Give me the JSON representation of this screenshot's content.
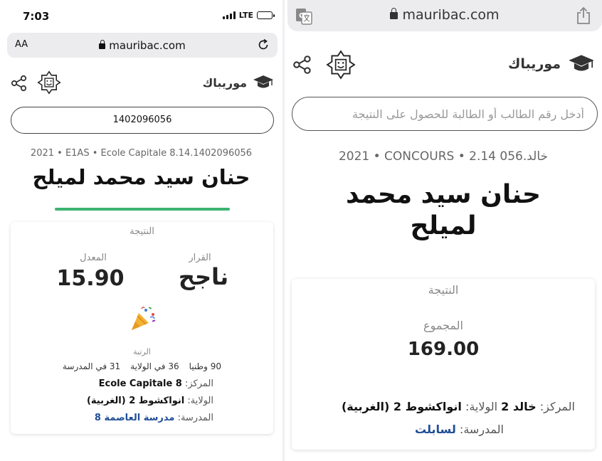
{
  "left": {
    "status_bar": {
      "time": "7:03",
      "network": "LTE"
    },
    "browser": {
      "aa": "AA",
      "url": "mauribac.com"
    },
    "header": {
      "brand": "موريباك"
    },
    "search": {
      "value": "1402096056"
    },
    "student": {
      "meta": "2021 • E1AS • Ecole Capitale 8.14.1402096056",
      "name": "حنان سيد محمد لميلح"
    },
    "result": {
      "title": "النتيجة",
      "decision_label": "القرار",
      "decision_value": "ناجح",
      "average_label": "المعدل",
      "average_value": "15.90",
      "rank_label": "الرتبة",
      "rank_school": "31 في المدرسة",
      "rank_wilaya": "36 في الولاية",
      "rank_national": "90 وطنيا",
      "center_label": "المركز:",
      "center_value": "Ecole Capitale 8",
      "wilaya_label": "الولاية:",
      "wilaya_value": "انواكشوط 2 (الغربية)",
      "school_label": "المدرسة:",
      "school_value": "مدرسة العاصمة 8"
    }
  },
  "right": {
    "browser": {
      "url": "mauribac.com"
    },
    "header": {
      "brand": "موريباك"
    },
    "search": {
      "placeholder": "أدخل رقم الطالب أو الطالبة للحصول على النتيجة"
    },
    "student": {
      "meta": "2021 • CONCOURS • 2.14 خالد.056",
      "name": "حنان سيد محمد لميلح"
    },
    "result": {
      "title": "النتيجة",
      "total_label": "المجموع",
      "total_value": "169.00",
      "center_label": "المركز:",
      "center_value": "خالد 2",
      "wilaya_label": "الولاية:",
      "wilaya_value": "انواكشوط 2 (الغربية)",
      "school_label": "المدرسة:",
      "school_value": "لسابلت"
    }
  },
  "colors": {
    "accent_green": "#3cb371",
    "link_blue": "#1f4e96"
  },
  "icons": [
    "share-icon",
    "emblem-icon",
    "graduation-cap-icon",
    "lock-icon",
    "reload-icon",
    "translate-icon",
    "upload-icon",
    "party-popper-icon"
  ]
}
